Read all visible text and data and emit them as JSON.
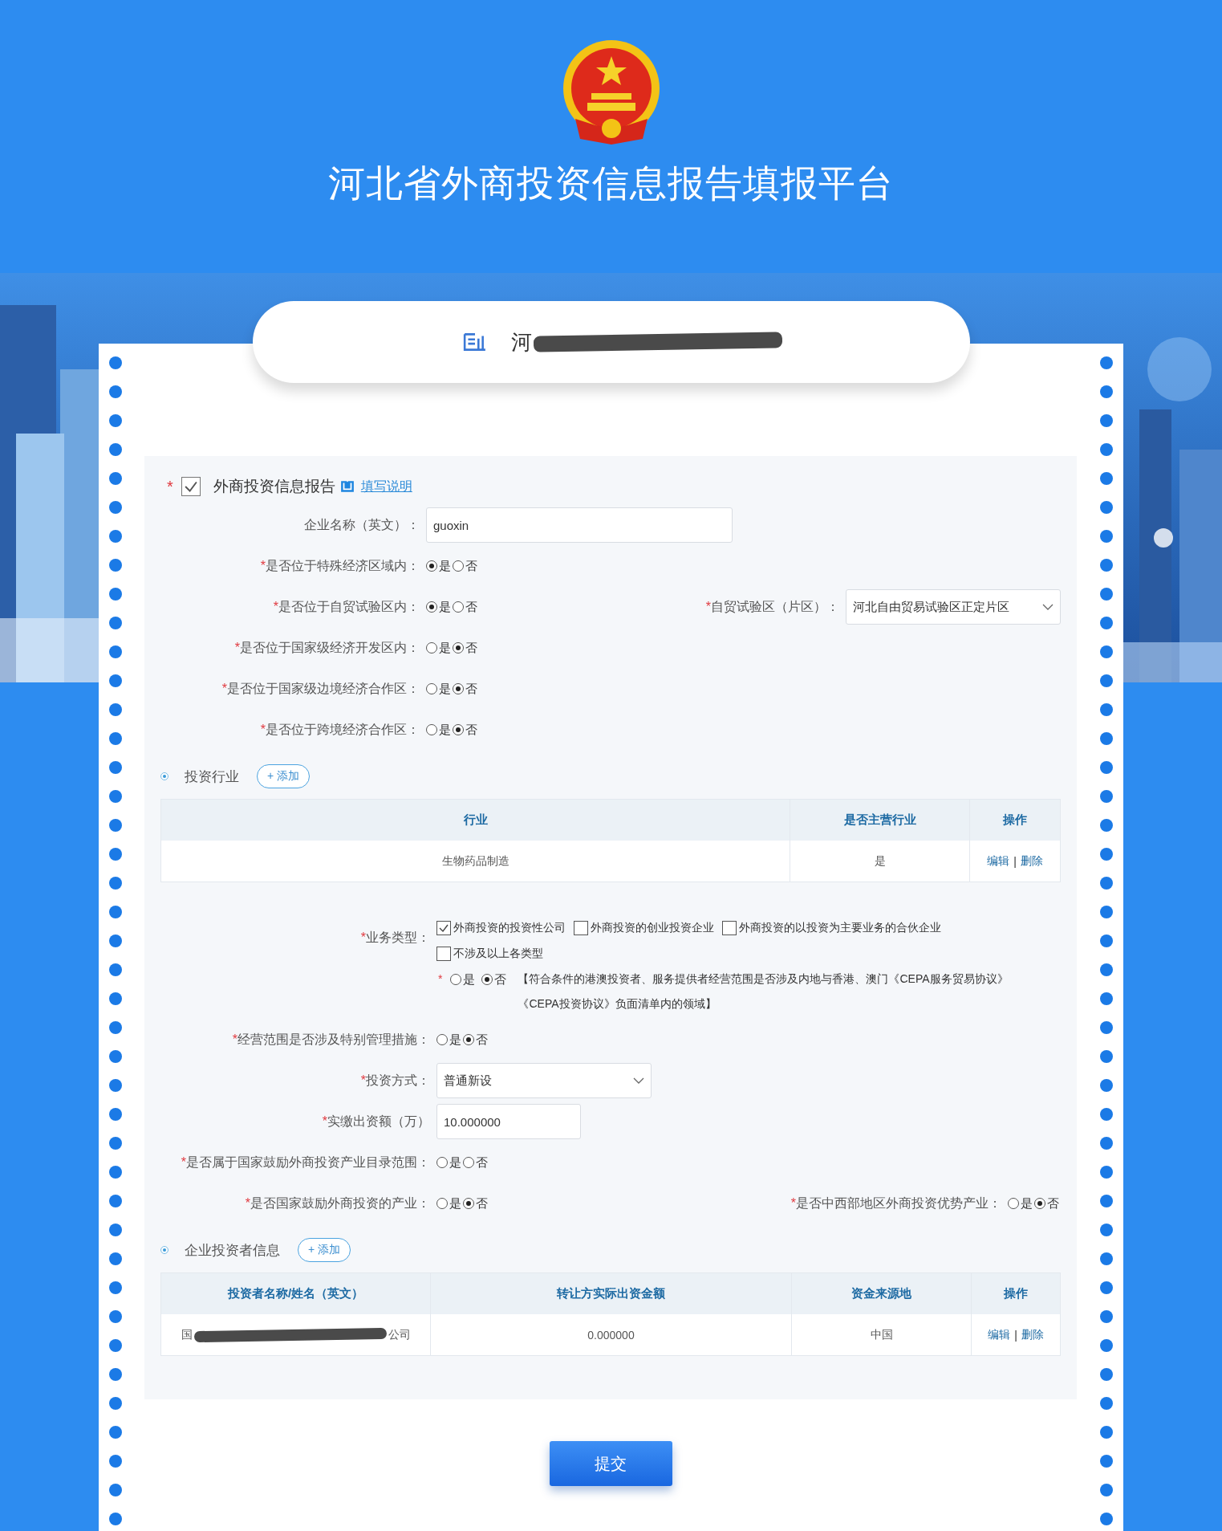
{
  "page_title": "河北省外商投资信息报告填报平台",
  "company": {
    "name_visible": "河"
  },
  "report": {
    "required_mark": "*",
    "checked": true,
    "title": "外商投资信息报告",
    "help_link": "填写说明"
  },
  "basic_rows": [
    {
      "fields": [
        {
          "kind": "text",
          "label": "企业名称（英文）：",
          "value": "guoxin"
        }
      ]
    },
    {
      "fields": [
        {
          "kind": "radio",
          "required_mark": "*",
          "label": "是否位于特殊经济区域内：",
          "options": [
            {
              "label": "是",
              "selected": true
            },
            {
              "label": "否",
              "selected": false
            }
          ]
        }
      ]
    },
    {
      "fields": [
        {
          "kind": "radio",
          "required_mark": "*",
          "label": "是否位于自贸试验区内：",
          "options": [
            {
              "label": "是",
              "selected": true
            },
            {
              "label": "否",
              "selected": false
            }
          ]
        },
        {
          "kind": "select",
          "required_mark": "*",
          "label": "自贸试验区（片区）：",
          "value": "河北自由贸易试验区正定片区"
        }
      ]
    },
    {
      "fields": [
        {
          "kind": "radio",
          "required_mark": "*",
          "label": "是否位于国家级经济开发区内：",
          "options": [
            {
              "label": "是",
              "selected": false
            },
            {
              "label": "否",
              "selected": true
            }
          ]
        }
      ]
    },
    {
      "fields": [
        {
          "kind": "radio",
          "required_mark": "*",
          "label": "是否位于国家级边境经济合作区：",
          "options": [
            {
              "label": "是",
              "selected": false
            },
            {
              "label": "否",
              "selected": true
            }
          ]
        }
      ]
    },
    {
      "fields": [
        {
          "kind": "radio",
          "required_mark": "*",
          "label": "是否位于跨境经济合作区：",
          "options": [
            {
              "label": "是",
              "selected": false
            },
            {
              "label": "否",
              "selected": true
            }
          ]
        }
      ]
    }
  ],
  "industry": {
    "title": "投资行业",
    "add_button": "+ 添加",
    "columns": [
      "行业",
      "是否主营行业",
      "操作"
    ],
    "rows": [
      {
        "cells": [
          "生物药品制造",
          "是"
        ],
        "actions": [
          "编辑",
          "删除"
        ],
        "separator": "|"
      }
    ]
  },
  "business_rows": [
    {
      "fields": [
        {
          "kind": "checkboxes",
          "required_mark": "*",
          "label": "业务类型：",
          "options": [
            {
              "label": "外商投资的投资性公司",
              "checked": true
            },
            {
              "label": "外商投资的创业投资企业",
              "checked": false
            },
            {
              "label": "外商投资的以投资为主要业务的合伙企业",
              "checked": false
            },
            {
              "label": "不涉及以上各类型",
              "checked": false
            }
          ]
        }
      ]
    },
    {
      "fields": [
        {
          "kind": "note",
          "required_mark": "*",
          "options": [
            {
              "label": "是",
              "selected": false
            },
            {
              "label": "否",
              "selected": true
            }
          ],
          "note": "【符合条件的港澳投资者、服务提供者经营范围是否涉及内地与香港、澳门《CEPA服务贸易协议》《CEPA投资协议》负面清单内的领域】"
        }
      ]
    },
    {
      "fields": [
        {
          "kind": "radio",
          "required_mark": "*",
          "label": "经营范围是否涉及特别管理措施：",
          "options": [
            {
              "label": "是",
              "selected": false
            },
            {
              "label": "否",
              "selected": true
            }
          ]
        }
      ]
    },
    {
      "fields": [
        {
          "kind": "select",
          "required_mark": "*",
          "label": "投资方式：",
          "value": "普通新设"
        }
      ]
    },
    {
      "fields": [
        {
          "kind": "text",
          "required_mark": "*",
          "label": "实缴出资额（万）",
          "value": "10.000000"
        }
      ]
    },
    {
      "fields": [
        {
          "kind": "radio",
          "required_mark": "*",
          "label": "是否属于国家鼓励外商投资产业目录范围：",
          "options": [
            {
              "label": "是",
              "selected": false
            },
            {
              "label": "否",
              "selected": false
            }
          ]
        }
      ]
    },
    {
      "fields": [
        {
          "kind": "radio",
          "required_mark": "*",
          "label": "是否国家鼓励外商投资的产业：",
          "options": [
            {
              "label": "是",
              "selected": false
            },
            {
              "label": "否",
              "selected": true
            }
          ]
        },
        {
          "kind": "radio",
          "required_mark": "*",
          "label": "是否中西部地区外商投资优势产业：",
          "options": [
            {
              "label": "是",
              "selected": false
            },
            {
              "label": "否",
              "selected": true
            }
          ]
        }
      ]
    }
  ],
  "investors": {
    "title": "企业投资者信息",
    "add_button": "+ 添加",
    "columns": [
      "投资者名称/姓名（英文）",
      "转让方实际出资金额",
      "资金来源地",
      "操作"
    ],
    "rows": [
      {
        "cells": [
          {
            "start": "国",
            "end": "公司"
          },
          "0.000000",
          "中国"
        ],
        "actions": [
          "编辑",
          "删除"
        ],
        "separator": "|"
      }
    ]
  },
  "submit": "提交"
}
